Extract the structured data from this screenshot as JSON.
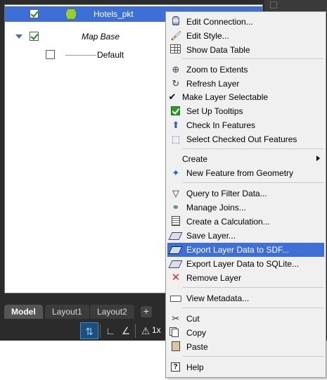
{
  "tree": {
    "rows": [
      {
        "label": "Hotels_pkt",
        "checked": true,
        "selected": true
      },
      {
        "label": "Map Base",
        "checked": true,
        "italic": true
      },
      {
        "label": "Default",
        "checked": false
      }
    ]
  },
  "tabs": [
    "Model",
    "Layout1",
    "Layout2"
  ],
  "tab_add": "+",
  "status": {
    "scale": "1x"
  },
  "menu": {
    "edit_connection": "Edit Connection...",
    "edit_style": "Edit Style...",
    "show_data_table": "Show Data Table",
    "zoom_to_extents": "Zoom to Extents",
    "refresh_layer": "Refresh Layer",
    "make_layer_selectable": "Make Layer Selectable",
    "set_up_tooltips": "Set Up Tooltips",
    "check_in_features": "Check In Features",
    "select_checked_out_features": "Select Checked Out Features",
    "create": "Create",
    "new_feature_from_geometry": "New Feature from Geometry",
    "query_to_filter_data": "Query to Filter Data...",
    "manage_joins": "Manage Joins...",
    "create_a_calculation": "Create a Calculation...",
    "save_layer": "Save Layer...",
    "export_layer_data_to_sdf": "Export Layer Data to SDF...",
    "export_layer_data_to_sqlite": "Export Layer Data to SQLite...",
    "remove_layer": "Remove Layer",
    "view_metadata": "View Metadata...",
    "cut": "Cut",
    "copy": "Copy",
    "paste": "Paste",
    "help": "Help"
  },
  "colors": {
    "highlight": "#3d6fd6",
    "frame": "#2b2b2b",
    "menu_bg": "#f0f0f0",
    "remove_x": "#d62a2a"
  }
}
